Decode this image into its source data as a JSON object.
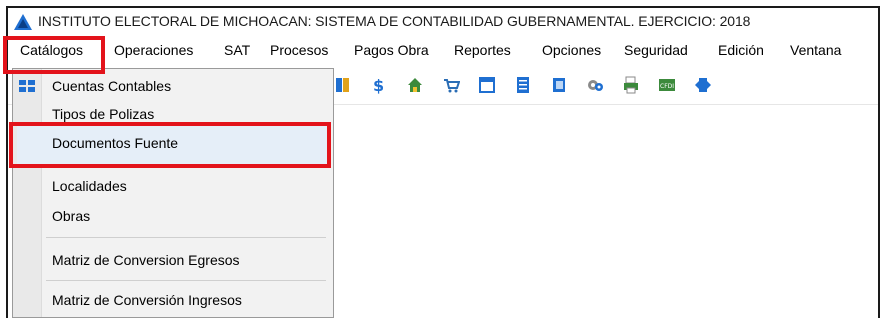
{
  "window": {
    "title": "INSTITUTO ELECTORAL DE MICHOACAN: SISTEMA DE CONTABILIDAD GUBERNAMENTAL. EJERCICIO: 2018"
  },
  "menubar": {
    "items": [
      "Catálogos",
      "Operaciones",
      "SAT",
      "Procesos",
      "Pagos Obra",
      "Reportes",
      "Opciones",
      "Seguridad",
      "Edición",
      "Ventana"
    ]
  },
  "catalogos_menu": {
    "items": [
      "Cuentas Contables",
      "Tipos de Polizas",
      "Documentos Fuente",
      "Localidades",
      "Obras",
      "Matriz de Conversion Egresos",
      "Matriz de Conversión Ingresos"
    ],
    "highlighted": "Documentos Fuente"
  },
  "toolbar": {
    "icons": [
      "book-icon",
      "dollar-icon",
      "house-icon",
      "cart-icon",
      "window-icon",
      "document-icon",
      "notebook-icon",
      "gears-icon",
      "printer-icon",
      "cfdi-icon",
      "exit-icon"
    ]
  },
  "colors": {
    "highlight_box": "#e3131b",
    "accent": "#1f6fd1",
    "menu_bg": "#f2f2f2"
  }
}
